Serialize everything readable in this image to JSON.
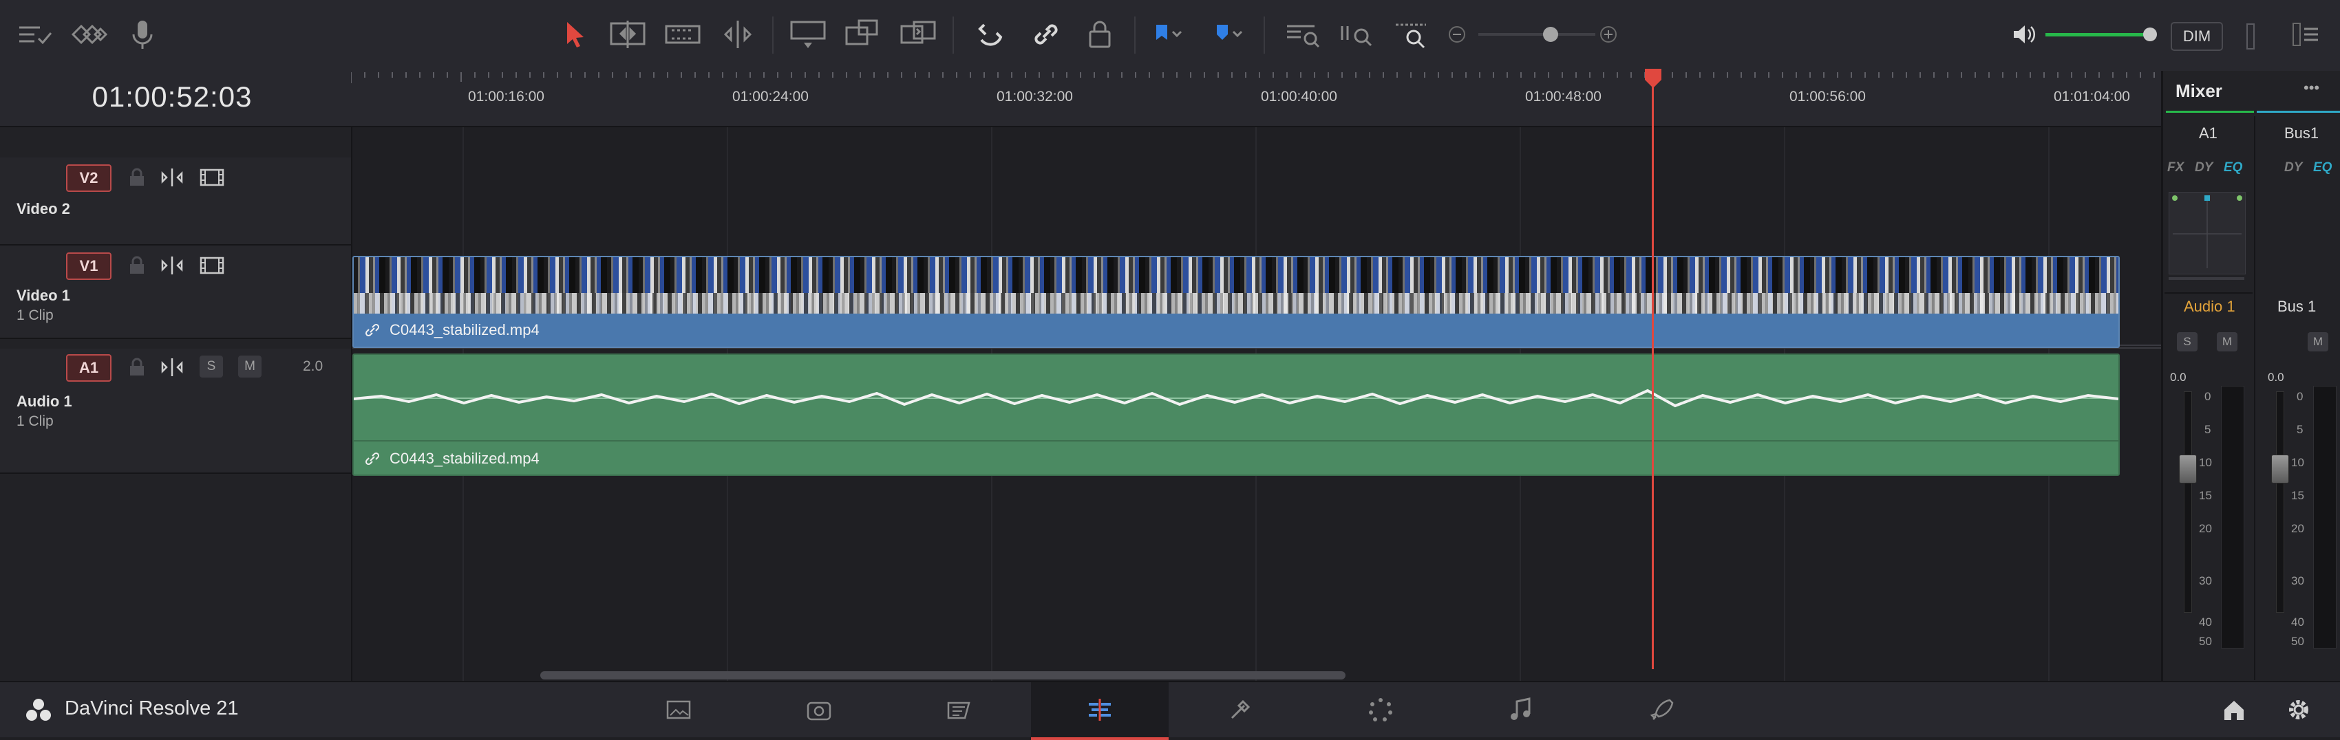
{
  "app": {
    "name": "DaVinci Resolve 21"
  },
  "toolbar": {
    "icons": [
      "timeline-options-icon",
      "track-view-icon",
      "voiceover-mic-icon",
      "selection-arrow-icon",
      "trim-edit-icon",
      "dynamic-trim-icon",
      "blade-icon",
      "insert-clip-icon",
      "overwrite-clip-icon",
      "replace-clip-icon",
      "snapping-icon",
      "linked-selection-icon",
      "position-lock-icon",
      "flag-icon",
      "marker-icon",
      "zoom-full-icon",
      "zoom-detail-icon",
      "zoom-custom-icon",
      "volume-icon"
    ],
    "dim_label": "DIM",
    "zoom_level": 0.62,
    "volume_level": 0.95
  },
  "header": {
    "timecode": "01:00:52:03"
  },
  "ruler": {
    "ticks": [
      "01:00:16:00",
      "01:00:24:00",
      "01:00:32:00",
      "01:00:40:00",
      "01:00:48:00",
      "01:00:56:00",
      "01:01:04:00"
    ]
  },
  "tracks": {
    "v2": {
      "badge": "V2",
      "name": "Video 2"
    },
    "v1": {
      "badge": "V1",
      "name": "Video 1",
      "clips": "1 Clip",
      "clip_name": "C0443_stabilized.mp4"
    },
    "a1": {
      "badge": "A1",
      "name": "Audio 1",
      "clips": "1 Clip",
      "clip_name": "C0443_stabilized.mp4",
      "solo": "S",
      "mute": "M",
      "channels": "2.0"
    }
  },
  "mixer": {
    "title": "Mixer",
    "ch1": {
      "label": "A1",
      "fx": "FX",
      "dy": "DY",
      "eq": "EQ",
      "name": "Audio 1",
      "solo": "S",
      "mute": "M",
      "value": "0.0"
    },
    "ch2": {
      "label": "Bus1",
      "dy": "DY",
      "eq": "EQ",
      "name": "Bus 1",
      "mute": "M",
      "value": "0.0"
    },
    "scale": [
      "0",
      "5",
      "10",
      "15",
      "20",
      "30",
      "40",
      "50"
    ],
    "colors": {
      "audio1": "#e3a33a",
      "eq": "#2fa9c7"
    }
  },
  "pages": {
    "items": [
      "media",
      "cut",
      "edit",
      "fusion",
      "color",
      "fairlight",
      "deliver"
    ],
    "active": "edit"
  },
  "colors": {
    "playhead": "#e0483f",
    "video_clip": "#4a78ad",
    "audio_clip": "#4b8a62",
    "badge": "#b94a4a"
  }
}
